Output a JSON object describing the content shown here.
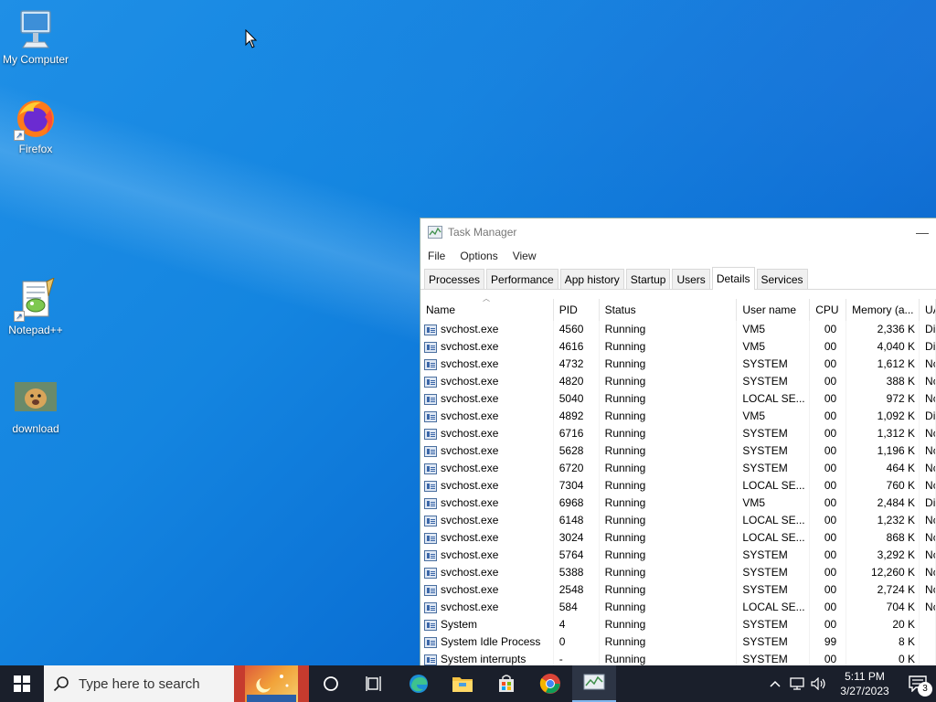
{
  "desktop": {
    "icons": [
      {
        "label": "My Computer"
      },
      {
        "label": "Firefox"
      },
      {
        "label": "Notepad++"
      },
      {
        "label": "download"
      }
    ]
  },
  "task_manager": {
    "title": "Task Manager",
    "menu": [
      "File",
      "Options",
      "View"
    ],
    "tabs": [
      "Processes",
      "Performance",
      "App history",
      "Startup",
      "Users",
      "Details",
      "Services"
    ],
    "active_tab": "Details",
    "columns": [
      "Name",
      "PID",
      "Status",
      "User name",
      "CPU",
      "Memory (a...",
      "UA"
    ],
    "rows": [
      {
        "name": "svchost.exe",
        "pid": "4560",
        "status": "Running",
        "user": "VM5",
        "cpu": "00",
        "mem": "2,336 K",
        "uac": "Di"
      },
      {
        "name": "svchost.exe",
        "pid": "4616",
        "status": "Running",
        "user": "VM5",
        "cpu": "00",
        "mem": "4,040 K",
        "uac": "Di"
      },
      {
        "name": "svchost.exe",
        "pid": "4732",
        "status": "Running",
        "user": "SYSTEM",
        "cpu": "00",
        "mem": "1,612 K",
        "uac": "Nc"
      },
      {
        "name": "svchost.exe",
        "pid": "4820",
        "status": "Running",
        "user": "SYSTEM",
        "cpu": "00",
        "mem": "388 K",
        "uac": "Nc"
      },
      {
        "name": "svchost.exe",
        "pid": "5040",
        "status": "Running",
        "user": "LOCAL SE...",
        "cpu": "00",
        "mem": "972 K",
        "uac": "Nc"
      },
      {
        "name": "svchost.exe",
        "pid": "4892",
        "status": "Running",
        "user": "VM5",
        "cpu": "00",
        "mem": "1,092 K",
        "uac": "Di"
      },
      {
        "name": "svchost.exe",
        "pid": "6716",
        "status": "Running",
        "user": "SYSTEM",
        "cpu": "00",
        "mem": "1,312 K",
        "uac": "Nc"
      },
      {
        "name": "svchost.exe",
        "pid": "5628",
        "status": "Running",
        "user": "SYSTEM",
        "cpu": "00",
        "mem": "1,196 K",
        "uac": "Nc"
      },
      {
        "name": "svchost.exe",
        "pid": "6720",
        "status": "Running",
        "user": "SYSTEM",
        "cpu": "00",
        "mem": "464 K",
        "uac": "Nc"
      },
      {
        "name": "svchost.exe",
        "pid": "7304",
        "status": "Running",
        "user": "LOCAL SE...",
        "cpu": "00",
        "mem": "760 K",
        "uac": "Nc"
      },
      {
        "name": "svchost.exe",
        "pid": "6968",
        "status": "Running",
        "user": "VM5",
        "cpu": "00",
        "mem": "2,484 K",
        "uac": "Di"
      },
      {
        "name": "svchost.exe",
        "pid": "6148",
        "status": "Running",
        "user": "LOCAL SE...",
        "cpu": "00",
        "mem": "1,232 K",
        "uac": "Nc"
      },
      {
        "name": "svchost.exe",
        "pid": "3024",
        "status": "Running",
        "user": "LOCAL SE...",
        "cpu": "00",
        "mem": "868 K",
        "uac": "Nc"
      },
      {
        "name": "svchost.exe",
        "pid": "5764",
        "status": "Running",
        "user": "SYSTEM",
        "cpu": "00",
        "mem": "3,292 K",
        "uac": "Nc"
      },
      {
        "name": "svchost.exe",
        "pid": "5388",
        "status": "Running",
        "user": "SYSTEM",
        "cpu": "00",
        "mem": "12,260 K",
        "uac": "Nc"
      },
      {
        "name": "svchost.exe",
        "pid": "2548",
        "status": "Running",
        "user": "SYSTEM",
        "cpu": "00",
        "mem": "2,724 K",
        "uac": "Nc"
      },
      {
        "name": "svchost.exe",
        "pid": "584",
        "status": "Running",
        "user": "LOCAL SE...",
        "cpu": "00",
        "mem": "704 K",
        "uac": "Nc"
      },
      {
        "name": "System",
        "pid": "4",
        "status": "Running",
        "user": "SYSTEM",
        "cpu": "00",
        "mem": "20 K",
        "uac": ""
      },
      {
        "name": "System Idle Process",
        "pid": "0",
        "status": "Running",
        "user": "SYSTEM",
        "cpu": "99",
        "mem": "8 K",
        "uac": ""
      },
      {
        "name": "System interrupts",
        "pid": "-",
        "status": "Running",
        "user": "SYSTEM",
        "cpu": "00",
        "mem": "0 K",
        "uac": ""
      }
    ]
  },
  "taskbar": {
    "search_placeholder": "Type here to search",
    "time": "5:11 PM",
    "date": "3/27/2023",
    "notification_count": "3"
  }
}
